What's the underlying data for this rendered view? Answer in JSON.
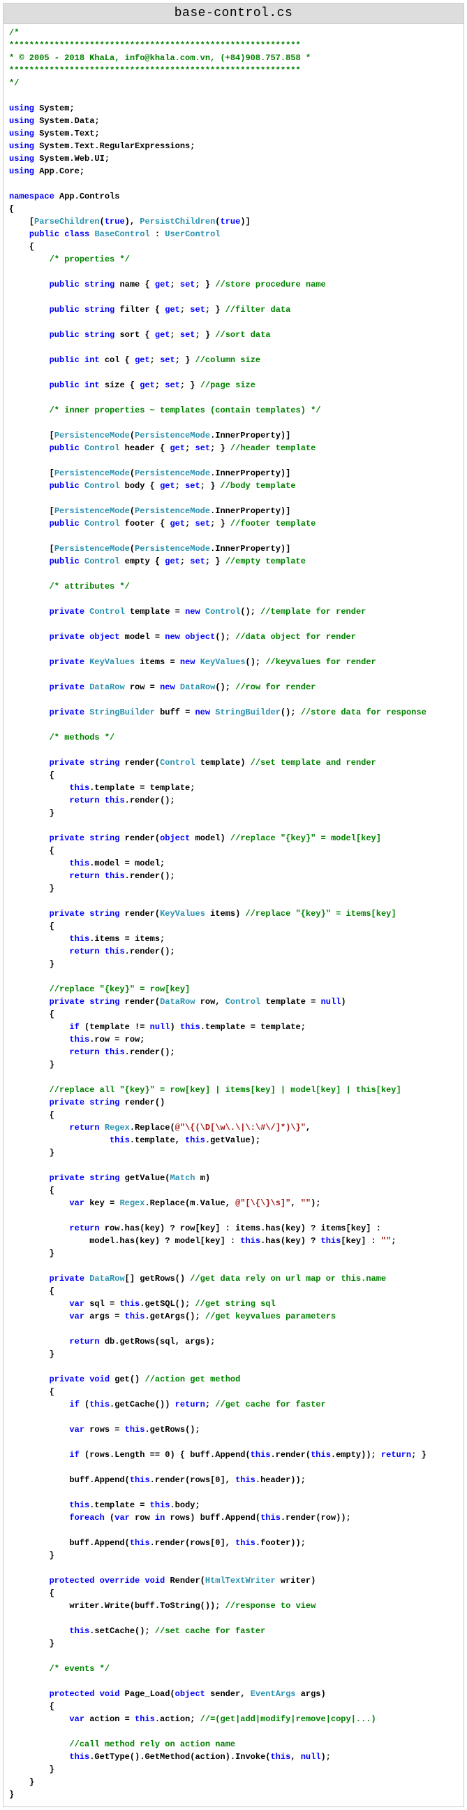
{
  "title": "base-control.cs",
  "code": {
    "header_comment": [
      "/*",
      "**********************************************************",
      "* © 2005 - 2018 KhaLa, info@khala.com.vn, (+84)908.757.858 *",
      "**********************************************************",
      "*/"
    ],
    "usings": [
      "System",
      "System.Data",
      "System.Text",
      "System.Text.RegularExpressions",
      "System.Web.UI",
      "App.Core"
    ],
    "namespace": "App.Controls",
    "attr_parse": "ParseChildren",
    "attr_persist": "PersistChildren",
    "attr_true": "true",
    "class_kw": "public class",
    "class_name": "BaseControl",
    "base_class": "UserControl",
    "cmt_props": "/* properties */",
    "props": [
      {
        "type": "string",
        "name": "name",
        "cmt": "//store procedure name"
      },
      {
        "type": "string",
        "name": "filter",
        "cmt": "//filter data"
      },
      {
        "type": "string",
        "name": "sort",
        "cmt": "//sort data"
      },
      {
        "type": "int",
        "name": "col",
        "cmt": "//column size"
      },
      {
        "type": "int",
        "name": "size",
        "cmt": "//page size"
      }
    ],
    "cmt_inner": "/* inner properties ~ templates (contain templates) */",
    "persist_mode": "PersistenceMode",
    "persist_enum": "PersistenceMode",
    "persist_val": "InnerProperty",
    "inner_props": [
      {
        "name": "header",
        "cmt": "//header template"
      },
      {
        "name": "body",
        "cmt": "//body template"
      },
      {
        "name": "footer",
        "cmt": "//footer template"
      },
      {
        "name": "empty",
        "cmt": "//empty template"
      }
    ],
    "control_type": "Control",
    "cmt_attrs": "/* attributes */",
    "fields": {
      "template": {
        "type": "Control",
        "init": "Control",
        "cmt": "//template for render"
      },
      "model": {
        "type": "object",
        "init": "object",
        "cmt": "//data object for render"
      },
      "items": {
        "type": "KeyValues",
        "init": "KeyValues",
        "cmt": "//keyvalues for render"
      },
      "row": {
        "type": "DataRow",
        "init": "DataRow",
        "cmt": "//row for render"
      },
      "buff": {
        "type": "StringBuilder",
        "init": "StringBuilder",
        "cmt": "//store data for response"
      }
    },
    "cmt_methods": "/* methods */",
    "render1_cmt": "//set template and render",
    "render2_cmt": "//replace \"{key}\" = model[key]",
    "render3_cmt": "//replace \"{key}\" = items[key]",
    "render4_cmt": "//replace \"{key}\" = row[key]",
    "render5_cmt": "//replace all \"{key}\" = row[key] | items[key] | model[key] | this[key]",
    "regex1": "@\"\\{(\\D[\\w\\.\\|\\:\\#\\/]*)\\}\"",
    "regex2": "@\"[\\{\\}\\s]\"",
    "empty_str": "\"\"",
    "getrows_cmt": "//get data rely on url map or this.name",
    "get_sql_cmt": "//get string sql",
    "get_args_cmt": "//get keyvalues parameters",
    "get_cmt": "//action get method",
    "cache_cmt": "//get cache for faster",
    "render_override_cmt": "//response to view",
    "set_cache_cmt": "//set cache for faster",
    "cmt_events": "/* events */",
    "action_cmt": "//=(get|add|modify|remove|copy|...)",
    "invoke_cmt": "//call method rely on action name",
    "kw": {
      "using": "using",
      "namespace": "namespace",
      "public": "public",
      "class": "class",
      "private": "private",
      "protected": "protected",
      "override": "override",
      "void": "void",
      "string": "string",
      "int": "int",
      "object": "object",
      "new": "new",
      "get": "get",
      "set": "set",
      "return": "return",
      "this": "this",
      "null": "null",
      "if": "if",
      "var": "var",
      "foreach": "foreach",
      "in": "in",
      "true": "true"
    },
    "types": {
      "Control": "Control",
      "KeyValues": "KeyValues",
      "DataRow": "DataRow",
      "StringBuilder": "StringBuilder",
      "Regex": "Regex",
      "Match": "Match",
      "HtmlTextWriter": "HtmlTextWriter",
      "EventArgs": "EventArgs"
    }
  }
}
